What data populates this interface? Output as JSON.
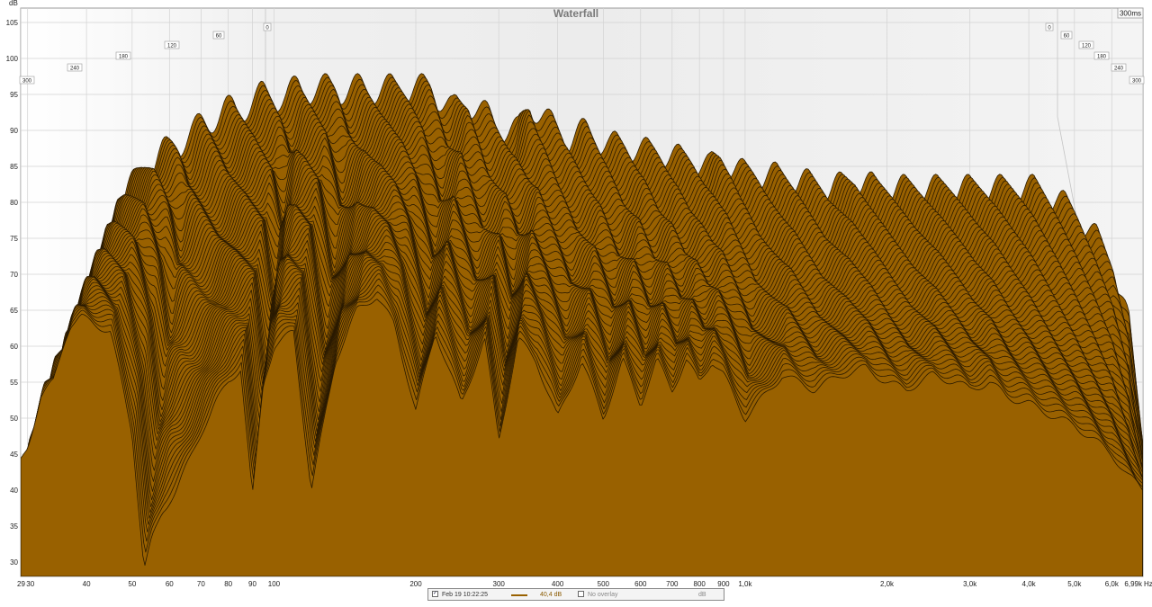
{
  "chart_data": {
    "type": "area",
    "title": "Waterfall",
    "ylabel": "dB",
    "xunit": "Hz",
    "x_scale": "log",
    "xlim": [
      29,
      6990
    ],
    "ylim": [
      28,
      107
    ],
    "y_ticks": [
      30,
      35,
      40,
      45,
      50,
      55,
      60,
      65,
      70,
      75,
      80,
      85,
      90,
      95,
      100,
      105
    ],
    "x_ticks": [
      {
        "value": 29,
        "label": "29"
      },
      {
        "value": 30,
        "label": "30"
      },
      {
        "value": 40,
        "label": "40"
      },
      {
        "value": 50,
        "label": "50"
      },
      {
        "value": 60,
        "label": "60"
      },
      {
        "value": 70,
        "label": "70"
      },
      {
        "value": 80,
        "label": "80"
      },
      {
        "value": 90,
        "label": "90"
      },
      {
        "value": 100,
        "label": "100"
      },
      {
        "value": 200,
        "label": "200"
      },
      {
        "value": 300,
        "label": "300"
      },
      {
        "value": 400,
        "label": "400"
      },
      {
        "value": 500,
        "label": "500"
      },
      {
        "value": 600,
        "label": "600"
      },
      {
        "value": 700,
        "label": "700"
      },
      {
        "value": 800,
        "label": "800"
      },
      {
        "value": 900,
        "label": "900"
      },
      {
        "value": 1000,
        "label": "1,0k"
      },
      {
        "value": 2000,
        "label": "2,0k"
      },
      {
        "value": 3000,
        "label": "3,0k"
      },
      {
        "value": 4000,
        "label": "4,0k"
      },
      {
        "value": 5000,
        "label": "5,0k"
      },
      {
        "value": 6000,
        "label": "6,0k"
      },
      {
        "value": 6990,
        "label": "6,99k"
      }
    ],
    "time_axis_label": "300ms",
    "time_ticks": [
      "0",
      "60",
      "120",
      "180",
      "240",
      "300"
    ],
    "grid": true,
    "fill_color": "#996100",
    "line_color": "#2a1a00",
    "slices": 60,
    "series": [
      {
        "x": [
          29,
          30,
          32,
          34,
          36,
          37,
          39,
          42,
          45,
          50,
          53,
          55,
          58,
          62,
          66,
          70,
          75,
          80,
          85,
          90,
          95,
          100,
          110,
          120,
          135,
          150,
          165,
          180,
          200,
          220,
          250,
          280,
          300,
          330,
          360,
          400,
          450,
          500,
          550,
          600,
          650,
          700,
          750,
          800,
          850,
          900,
          1000,
          1200,
          1400,
          1600,
          1800,
          2000,
          2200,
          2500,
          2800,
          3000,
          3300,
          3600,
          4000,
          4300,
          4600,
          5000,
          5500,
          6000,
          6500,
          6990
        ],
        "y": [
          44,
          46,
          53,
          55,
          61,
          63,
          64,
          63,
          62,
          48,
          29,
          33,
          37,
          40,
          44,
          48,
          52,
          55,
          57,
          39,
          55,
          60,
          62,
          40,
          58,
          65,
          67,
          63,
          51,
          62,
          52,
          61,
          47,
          61,
          58,
          50,
          58,
          50,
          58,
          52,
          58,
          54,
          58,
          55,
          58,
          56,
          50,
          56,
          54,
          56,
          57,
          55,
          54,
          56,
          55,
          54,
          55,
          53,
          52,
          51,
          50,
          49,
          47,
          45,
          42,
          40
        ]
      },
      {
        "x": [
          29,
          30,
          32,
          34,
          36,
          37,
          39,
          42,
          45,
          50,
          53,
          55,
          58,
          62,
          66,
          70,
          75,
          80,
          85,
          90,
          95,
          100,
          110,
          120,
          135,
          150,
          165,
          180,
          200,
          220,
          250,
          280,
          300,
          330,
          360,
          400,
          450,
          500,
          550,
          600,
          650,
          700,
          750,
          800,
          850,
          900,
          1000,
          1200,
          1400,
          1600,
          1800,
          2000,
          2200,
          2500,
          2800,
          3000,
          3300,
          3600,
          4000,
          4300,
          4600,
          5000,
          5500,
          6000,
          6500,
          6990
        ],
        "y": [
          56,
          60,
          68,
          72,
          77,
          80,
          82,
          84,
          86,
          88,
          89,
          90,
          91,
          92,
          92,
          93,
          94,
          94,
          94,
          95,
          95,
          95,
          95,
          95,
          95,
          95,
          95,
          95,
          92,
          93,
          90,
          89,
          93,
          90,
          88,
          89,
          87,
          87,
          86,
          86,
          85,
          85,
          84,
          85,
          84,
          83,
          83,
          82,
          81,
          82,
          81,
          81,
          81,
          81,
          81,
          81,
          81,
          81,
          81,
          80,
          79,
          77,
          74,
          70,
          62,
          44
        ]
      }
    ]
  },
  "legend": {
    "date_label": "Feb 19 10:22:25",
    "level_label": "40,4 dB",
    "overlay_label": "No overlay",
    "unit_label": "dB"
  }
}
